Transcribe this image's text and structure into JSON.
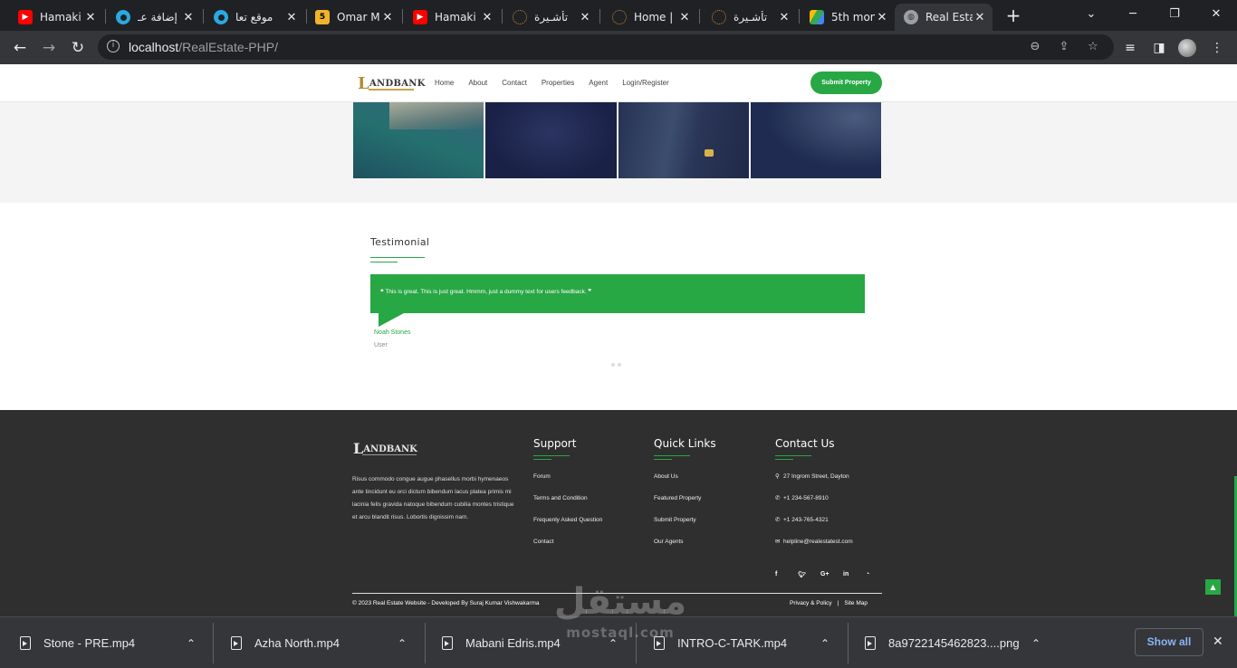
{
  "tabs": [
    {
      "title": "Hamaki",
      "fav": "youtube-icon",
      "favcolor": "#ff0000",
      "active": false
    },
    {
      "title": "إضافة عـ",
      "fav": "mostaql-icon",
      "favcolor": "#2aa9e0",
      "active": false
    },
    {
      "title": "موقع تعا",
      "fav": "mostaql-icon",
      "favcolor": "#2aa9e0",
      "active": false
    },
    {
      "title": "Omar M",
      "fav": "numbered-icon",
      "favcolor": "#f0b429",
      "active": false
    },
    {
      "title": "Hamaki",
      "fav": "youtube-icon",
      "favcolor": "#ff0000",
      "active": false
    },
    {
      "title": "تأشـيرة",
      "fav": "loading-icon",
      "favcolor": "#c98a3a",
      "active": false
    },
    {
      "title": "Home |",
      "fav": "loading-icon",
      "favcolor": "#c98a3a",
      "active": false
    },
    {
      "title": "تأشـيرة",
      "fav": "loading-icon",
      "favcolor": "#c98a3a",
      "active": false
    },
    {
      "title": "5th mon",
      "fav": "drive-icon",
      "favcolor": "#34a853",
      "active": false
    },
    {
      "title": "Real Esta",
      "fav": "globe-icon",
      "favcolor": "#9aa0a6",
      "active": true
    }
  ],
  "tab5_badge": "5",
  "address": {
    "host": "localhost",
    "path": "/RealEstate-PHP/"
  },
  "site": {
    "logo_big": "L",
    "logo_rest": "ANDBANK",
    "nav": [
      "Home",
      "About",
      "Contact",
      "Properties",
      "Agent",
      "Login/Register"
    ],
    "submit_label": "Submit Property"
  },
  "testimonial": {
    "heading": "Testimonial",
    "quote": "This is great. This is just great. Hmmm, just a dummy text for users feedback.",
    "name": "Noah Stones",
    "role": "User"
  },
  "footer": {
    "logo_big": "L",
    "logo_rest": "ANDBANK",
    "about": "Risus commodo congue augue phasellus morbi hymenaeos ante tincidunt eu orci dictum bibendum lacus platea primis mi lacinia felis gravida natoque bibendum cubilia montes tristique et arcu blandit risus. Lobortis dignissim nam.",
    "support": {
      "title": "Support",
      "items": [
        "Forum",
        "Terms and Condition",
        "Frequenly Asked Question",
        "Contact"
      ]
    },
    "quick": {
      "title": "Quick Links",
      "items": [
        "About Us",
        "Featured Property",
        "Submit Property",
        "Our Agents"
      ]
    },
    "contact": {
      "title": "Contact Us",
      "items": [
        "27 Ingrom Street, Dayton",
        "+1 234-567-8910",
        "+1 243-765-4321",
        "helpline@realestatest.com"
      ]
    },
    "socials": [
      "f",
      "t",
      "G+",
      "in",
      "rss"
    ],
    "copyright": "© 2023 Real Estate Website - Developed By Suraj Kumar Vishwakarma",
    "privacy": "Privacy & Policy",
    "sitemap": "Site Map",
    "divider": "|"
  },
  "downloads": [
    {
      "name": "Stone - PRE.mp4"
    },
    {
      "name": "Azha North.mp4"
    },
    {
      "name": "Mabani Edris.mp4"
    },
    {
      "name": "INTRO-C-TARK.mp4"
    },
    {
      "name": "8a9722145462823....png"
    }
  ],
  "show_all": "Show all",
  "watermark": {
    "arabic": "مستقل",
    "latin": "mostaql.com"
  },
  "colors": {
    "accent": "#28a745",
    "footer": "#2f2f2f",
    "chrome_dark": "#202124"
  }
}
